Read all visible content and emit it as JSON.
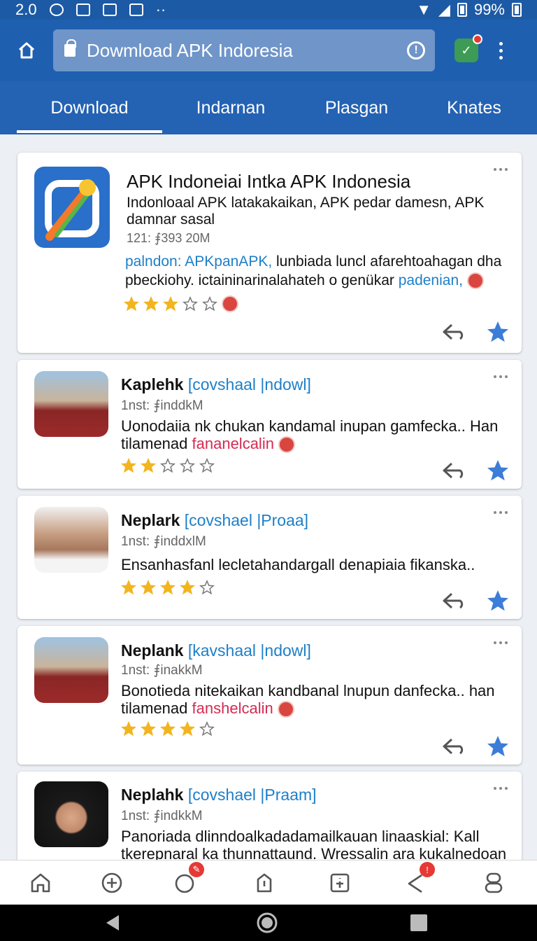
{
  "status_bar": {
    "time": "2.0",
    "battery": "99%"
  },
  "browser": {
    "url": "Dowmload APK Indoresia",
    "extension_badge": "✓"
  },
  "tabs": [
    "Download",
    "Indarnan",
    "Plasgan",
    "Knates"
  ],
  "featured": {
    "title": "APK Indoneiai Intka APK Indonesia",
    "subtitle": "Indonloaal APK latakakaikan, APK pedar damesn, APK damnar sasal",
    "meta": "121: ⨎393 20M",
    "desc_link1": "palndon: APKpanAPK,",
    "desc_text": " lunbiada luncl afarehtoahagan dha pbeckiohy. ictaininarinalahateh o genükar ",
    "desc_link2": "padenian,",
    "rating": 3
  },
  "reviews": [
    {
      "name": "Kaplehk",
      "category": "[covshaal |ndowl]",
      "meta": "1nst: ⨎inddkM",
      "text": "Uonodaiia nk chukan kandamal inupan gamfecka.. Han tilamenad ",
      "highlight": "fananelcalin",
      "rating": 2
    },
    {
      "name": "Neplark",
      "category": "[covshael |Proaa]",
      "meta": "1nst: ⨎inddxlM",
      "text": "Ensanhasfanl lecletahandargall denapiaia fikanska..",
      "highlight": "",
      "rating": 4
    },
    {
      "name": "Neplank",
      "category": "[kavshaal |ndowl]",
      "meta": "1nst: ⨎inakkM",
      "text": "Bonotieda nitekaikan kandbanal lnupun danfecka.. han tilamenad ",
      "highlight": "fanshelcalin",
      "rating": 4
    },
    {
      "name": "Neplahk",
      "category": "[covshael |Praam]",
      "meta": "1nst: ⨎indkkM",
      "text": "Panoriada dlinndoalkadadamailkauan linaaskial: Kall tkerepnaral ka thunnattaund. Wressalin ara kukalnedoan",
      "highlight": "",
      "rating": 0
    }
  ],
  "bottom_nav": [
    "home",
    "add",
    "explore",
    "downloads",
    "info",
    "share",
    "profile"
  ],
  "colors": {
    "brand": "#1f5fb0",
    "accent": "#1e7fc7",
    "star": "#f2b51f",
    "fav": "#3b7dd8"
  }
}
